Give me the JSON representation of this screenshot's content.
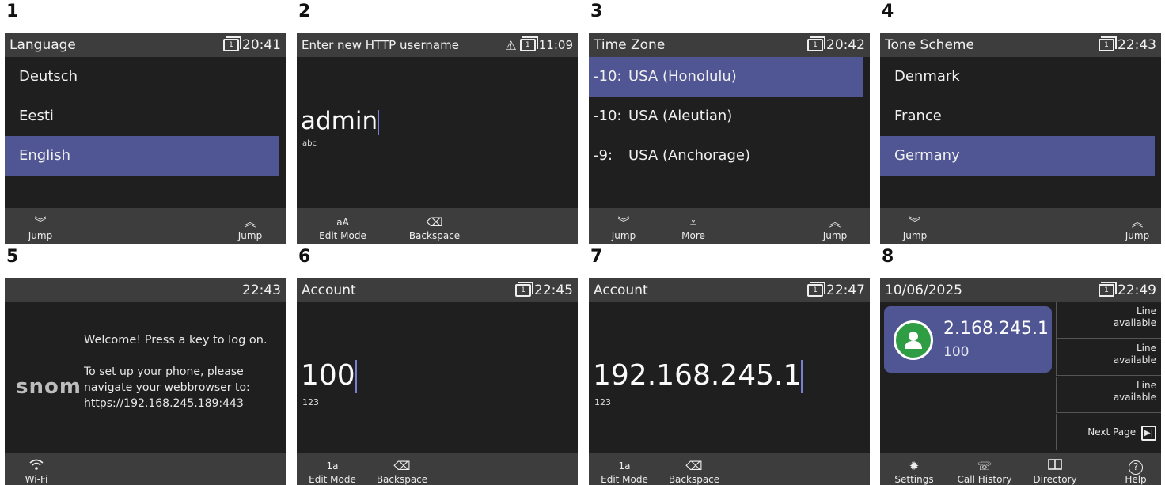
{
  "panels": [
    {
      "number": "1",
      "header": {
        "title": "Language",
        "line": "1",
        "time": "20:41"
      },
      "items": [
        {
          "label": "Deutsch",
          "selected": false
        },
        {
          "label": "Eesti",
          "selected": false
        },
        {
          "label": "English",
          "selected": true
        }
      ],
      "softkeys": [
        {
          "icon": "double-chevron-down-icon",
          "glyph": "≫",
          "label": "Jump"
        },
        {
          "icon": "double-chevron-up-icon",
          "glyph": "≪",
          "label": "Jump"
        }
      ]
    },
    {
      "number": "2",
      "header": {
        "title": "Enter new HTTP username",
        "line": "1",
        "time": "11:09",
        "warning_glyph": "⚠"
      },
      "input": {
        "value": "admin",
        "mode": "abc"
      },
      "softkeys": [
        {
          "icon": "edit-mode-icon",
          "glyph": "aA",
          "label": "Edit Mode"
        },
        {
          "icon": "backspace-icon",
          "glyph": "⌫",
          "label": "Backspace"
        }
      ]
    },
    {
      "number": "3",
      "header": {
        "title": "Time Zone",
        "line": "1",
        "time": "20:42"
      },
      "items": [
        {
          "offset": "-10:",
          "label": "USA (Honolulu)",
          "selected": true
        },
        {
          "offset": "-10:",
          "label": "USA (Aleutian)",
          "selected": false
        },
        {
          "offset": "-9:",
          "label": "USA (Anchorage)",
          "selected": false
        }
      ],
      "softkeys": [
        {
          "icon": "double-chevron-down-icon",
          "glyph": "≫",
          "label": "Jump"
        },
        {
          "icon": "more-icon",
          "glyph": "☰",
          "label": "More"
        },
        {
          "icon": "double-chevron-up-icon",
          "glyph": "≪",
          "label": "Jump"
        }
      ]
    },
    {
      "number": "4",
      "header": {
        "title": "Tone Scheme",
        "line": "1",
        "time": "22:43"
      },
      "items": [
        {
          "label": "Denmark",
          "selected": false
        },
        {
          "label": "France",
          "selected": false
        },
        {
          "label": "Germany",
          "selected": true
        }
      ],
      "softkeys": [
        {
          "icon": "double-chevron-down-icon",
          "glyph": "≫",
          "label": "Jump"
        },
        {
          "icon": "double-chevron-up-icon",
          "glyph": "≪",
          "label": "Jump"
        }
      ]
    },
    {
      "number": "5",
      "header": {
        "title": "",
        "time": "22:43"
      },
      "logo": "snom",
      "welcome": "Welcome! Press a key to log on.",
      "instructions": [
        "To set up your phone, please",
        "navigate your webbrowser to:",
        "https://192.168.245.189:443"
      ],
      "softkeys": [
        {
          "icon": "wifi-icon",
          "glyph": "≋",
          "label": "Wi-Fi"
        }
      ]
    },
    {
      "number": "6",
      "header": {
        "title": "Account",
        "line": "1",
        "time": "22:45"
      },
      "input": {
        "value": "100",
        "mode": "123"
      },
      "softkeys": [
        {
          "icon": "edit-mode-icon",
          "glyph": "1a",
          "label": "Edit Mode"
        },
        {
          "icon": "backspace-icon",
          "glyph": "⌫",
          "label": "Backspace"
        }
      ]
    },
    {
      "number": "7",
      "header": {
        "title": "Account",
        "line": "1",
        "time": "22:47"
      },
      "input": {
        "value": "192.168.245.1",
        "mode": "123"
      },
      "softkeys": [
        {
          "icon": "edit-mode-icon",
          "glyph": "1a",
          "label": "Edit Mode"
        },
        {
          "icon": "backspace-icon",
          "glyph": "⌫",
          "label": "Backspace"
        }
      ]
    },
    {
      "number": "8",
      "header": {
        "title": "10/06/2025",
        "line": "1",
        "time": "22:49"
      },
      "identity": {
        "number": "2.168.245.1",
        "extension": "100"
      },
      "lines": [
        {
          "text1": "Line",
          "text2": "available"
        },
        {
          "text1": "Line",
          "text2": "available"
        },
        {
          "text1": "Line",
          "text2": "available"
        }
      ],
      "next_page": "Next Page",
      "softkeys": [
        {
          "icon": "settings-icon",
          "glyph": "✹",
          "label": "Settings"
        },
        {
          "icon": "call-history-icon",
          "glyph": "☏",
          "label": "Call History"
        },
        {
          "icon": "directory-icon",
          "glyph": "▭",
          "label": "Directory"
        },
        {
          "icon": "help-icon",
          "glyph": "?",
          "label": "Help"
        }
      ]
    }
  ],
  "colors": {
    "selection": "#4f5693",
    "header": "#3d3d3d",
    "screen": "#1f1f1f",
    "avatar": "#2f9d44"
  }
}
